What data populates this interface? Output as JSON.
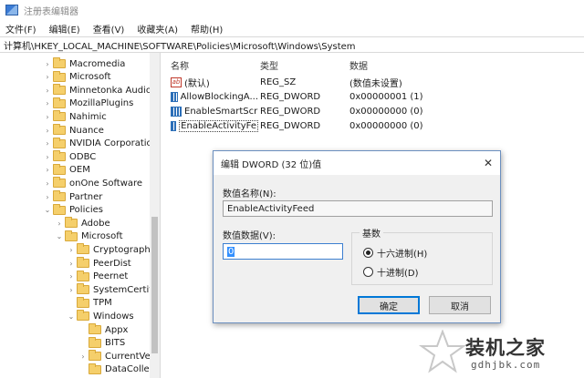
{
  "window": {
    "title": "注册表编辑器"
  },
  "menu": {
    "items": [
      "文件(F)",
      "编辑(E)",
      "查看(V)",
      "收藏夹(A)",
      "帮助(H)"
    ]
  },
  "address": {
    "path": "计算机\\HKEY_LOCAL_MACHINE\\SOFTWARE\\Policies\\Microsoft\\Windows\\System"
  },
  "tree": {
    "items": [
      {
        "label": "Macromedia",
        "expander": ">"
      },
      {
        "label": "Microsoft",
        "expander": ">"
      },
      {
        "label": "Minnetonka Audio S",
        "expander": ">"
      },
      {
        "label": "MozillaPlugins",
        "expander": ">"
      },
      {
        "label": "Nahimic",
        "expander": ">"
      },
      {
        "label": "Nuance",
        "expander": ">"
      },
      {
        "label": "NVIDIA Corporation",
        "expander": ">"
      },
      {
        "label": "ODBC",
        "expander": ">"
      },
      {
        "label": "OEM",
        "expander": ">"
      },
      {
        "label": "onOne Software",
        "expander": ">"
      },
      {
        "label": "Partner",
        "expander": ">"
      },
      {
        "label": "Policies",
        "expander": "v"
      },
      {
        "label": "Adobe",
        "expander": ">"
      },
      {
        "label": "Microsoft",
        "expander": "v"
      },
      {
        "label": "Cryptography",
        "expander": ">"
      },
      {
        "label": "PeerDist",
        "expander": ">"
      },
      {
        "label": "Peernet",
        "expander": ">"
      },
      {
        "label": "SystemCertific",
        "expander": ">"
      },
      {
        "label": "TPM",
        "expander": ""
      },
      {
        "label": "Windows",
        "expander": "v"
      },
      {
        "label": "Appx",
        "expander": ""
      },
      {
        "label": "BITS",
        "expander": ""
      },
      {
        "label": "CurrentVers",
        "expander": ">"
      },
      {
        "label": "DataCollect",
        "expander": ""
      }
    ]
  },
  "list": {
    "columns": {
      "name": "名称",
      "type": "类型",
      "data": "数据"
    },
    "rows": [
      {
        "name": "(默认)",
        "type": "REG_SZ",
        "data": "(数值未设置)",
        "icon": "string-value-icon"
      },
      {
        "name": "AllowBlockingA...",
        "type": "REG_DWORD",
        "data": "0x00000001 (1)",
        "icon": "dword-value-icon"
      },
      {
        "name": "EnableSmartScr",
        "type": "REG_DWORD",
        "data": "0x00000000 (0)",
        "icon": "dword-value-icon"
      },
      {
        "name": "EnableActivityFe",
        "type": "REG_DWORD",
        "data": "0x00000000 (0)",
        "icon": "dword-value-icon"
      }
    ]
  },
  "dialog": {
    "title": "编辑 DWORD (32 位)值",
    "close": "✕",
    "name_label": "数值名称(N):",
    "name_value": "EnableActivityFeed",
    "data_label": "数值数据(V):",
    "data_value": "0",
    "base_label": "基数",
    "hex_label": "十六进制(H)",
    "dec_label": "十进制(D)",
    "base_selected": "hex",
    "ok_label": "确定",
    "cancel_label": "取消"
  },
  "watermark": {
    "main": "装机之家",
    "sub": "gdhjbk.com"
  }
}
